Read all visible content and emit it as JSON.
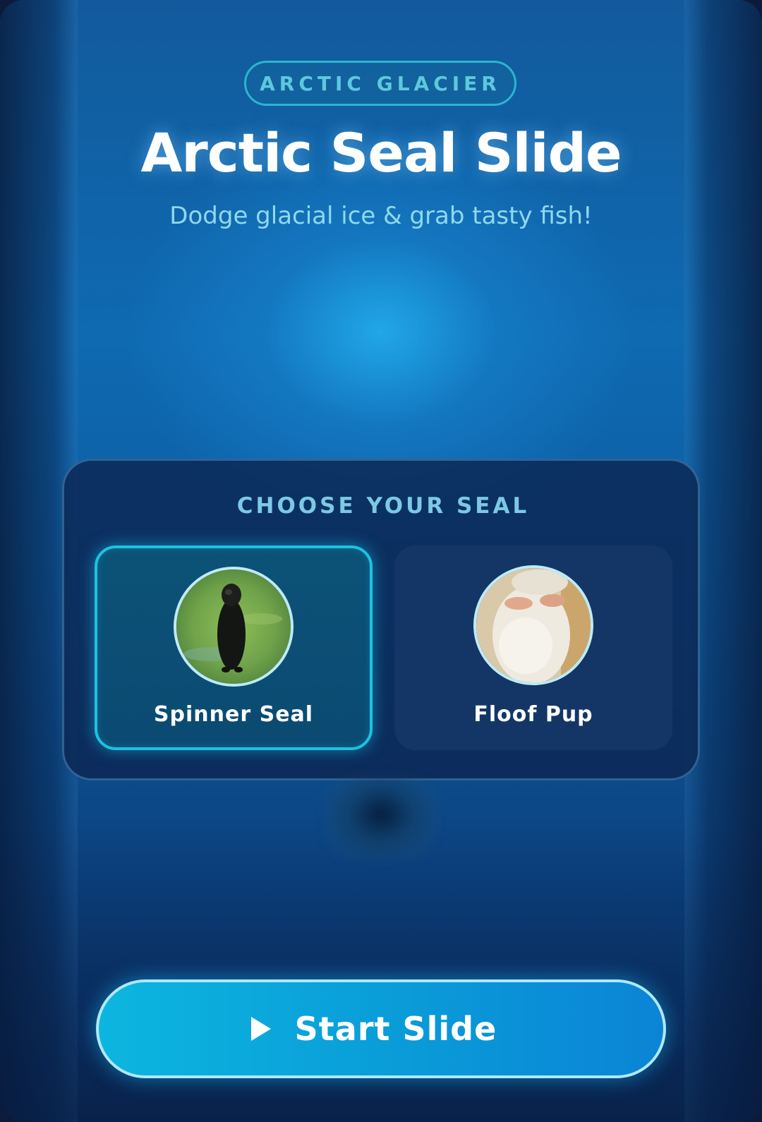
{
  "region_badge": "ARCTIC GLACIER",
  "title": "Arctic Seal Slide",
  "subtitle": "Dodge glacial ice & grab tasty fish!",
  "picker": {
    "heading": "CHOOSE YOUR SEAL",
    "seals": [
      {
        "name": "Spinner Seal",
        "selected": true
      },
      {
        "name": "Floof Pup",
        "selected": false
      }
    ]
  },
  "start_button": {
    "label": "Start Slide",
    "icon": "play-icon"
  },
  "colors": {
    "accent": "#1cc2e0",
    "button_start": "#0cb6df",
    "button_end": "#0b84d6",
    "panel": "#0b2652"
  }
}
